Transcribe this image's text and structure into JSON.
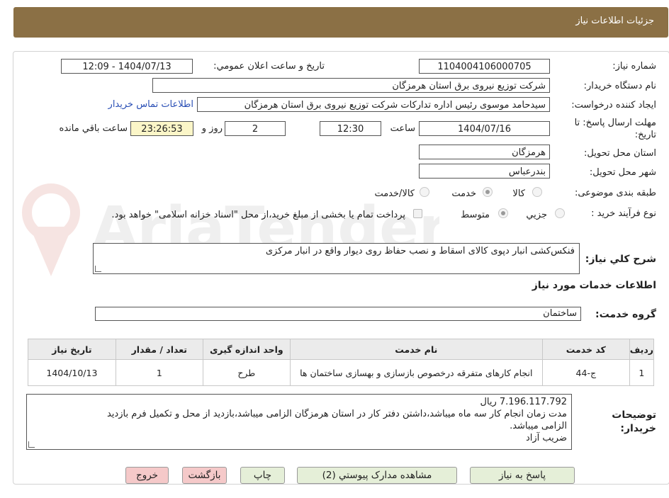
{
  "header": {
    "title": "جزئیات اطلاعات نیاز"
  },
  "form": {
    "need_number_label": "شماره نیاز:",
    "need_number": "1104004106000705",
    "announce_label": "تاریخ و ساعت اعلان عمومي:",
    "announce_value": "1404/07/13 - 12:09",
    "buyer_org_label": "نام دستگاه خريدار:",
    "buyer_org": "شرکت توزیع نیروی برق استان هرمزگان",
    "creator_label": "ايجاد کننده درخواست:",
    "creator": "سیدحامد موسوی رئیس اداره تدارکات شرکت توزیع نیروی برق استان هرمزگان",
    "contact_link": "اطلاعات تماس خريدار",
    "deadline_label_1": "مهلت ارسال پاسخ: تا",
    "deadline_label_2": "تاریخ:",
    "deadline_date": "1404/07/16",
    "time_label": "ساعت",
    "deadline_time": "12:30",
    "days_value": "2",
    "days_label": "روز و",
    "remaining_time": "23:26:53",
    "remaining_label": "ساعت باقي مانده",
    "province_label": "استان محل تحویل:",
    "province": "هرمزگان",
    "city_label": "شهر محل تحویل:",
    "city": "بندرعباس",
    "category_label": "طبقه بندی موضوعی:",
    "category_options": [
      "کالا",
      "خدمت",
      "کالا/خدمت"
    ],
    "category_selected": "خدمت",
    "process_label": "نوع فرآیند خرید :",
    "process_options": [
      "جزيي",
      "متوسط"
    ],
    "process_selected": "متوسط",
    "payment_note": "پرداخت تمام یا بخشی از مبلغ خرید،از محل \"اسناد خزانه اسلامی\" خواهد بود."
  },
  "description": {
    "label": "شرح كلي نياز:",
    "value": "فنکس‌کشی انبار دپوی کالای اسقاط و نصب حفاظ روی دیوار واقع در انبار مرکزی"
  },
  "services": {
    "section_title": "اطلاعات خدمات مورد نياز",
    "group_label": "گروه خدمت:",
    "group_value": "ساختمان",
    "columns": [
      "رديف",
      "کد خدمت",
      "نام خدمت",
      "واحد اندازه گيری",
      "تعداد / مقدار",
      "تاريخ نياز"
    ],
    "rows": [
      [
        "1",
        "ج-44",
        "انجام کارهای متفرقه درخصوص بازسازی و بهسازی ساختمان ها",
        "طرح",
        "1",
        "1404/10/13"
      ]
    ]
  },
  "buyer_notes": {
    "label_1": "توضيحات",
    "label_2": "خريدار:",
    "lines": [
      "7.196.117.792 ریال",
      "مدت زمان انجام کار سه ماه میباشد،داشتن دفتر کار در استان هرمزگان الزامی میباشد،بازدید از محل و تکمیل فرم بازدید",
      "الزامی میباشد.",
      "ضریب آزاد"
    ]
  },
  "buttons": {
    "reply": "پاسخ به نياز",
    "attachments": "مشاهده مدارک پيوستي (2)",
    "print": "چاپ",
    "back": "بازگشت",
    "exit": "خروج"
  },
  "watermark": {
    "text": "AriaTender.neT"
  },
  "colors": {
    "header_bg": "#8b7045",
    "button_green": "#e5efd8",
    "button_red": "#f5c9c9",
    "highlight_yellow": "#fbf6c8",
    "link_blue": "#2a4fb5"
  }
}
